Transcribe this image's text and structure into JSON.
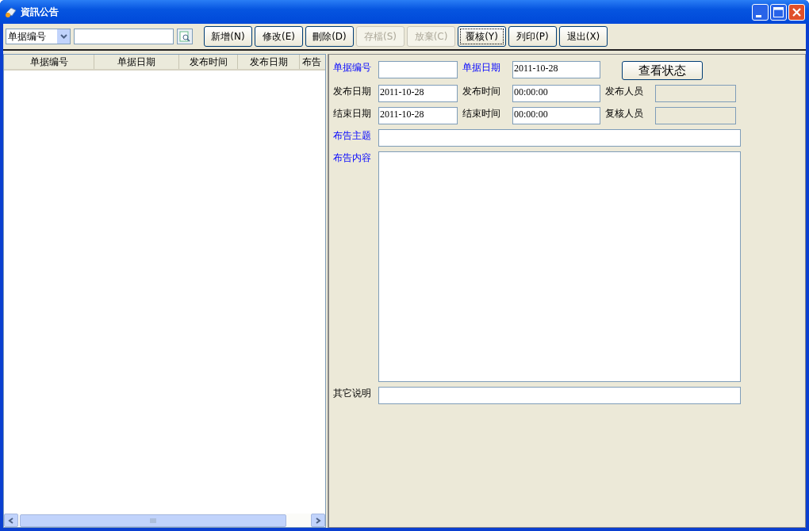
{
  "window": {
    "title": "資訊公告"
  },
  "toolbar": {
    "filter_field": {
      "value": "单据编号"
    },
    "buttons": [
      {
        "label": "新增(N)",
        "disabled": false,
        "focused": false
      },
      {
        "label": "修改(E)",
        "disabled": false,
        "focused": false
      },
      {
        "label": "刪除(D)",
        "disabled": false,
        "focused": false
      },
      {
        "label": "存檔(S)",
        "disabled": true,
        "focused": false
      },
      {
        "label": "放棄(C)",
        "disabled": true,
        "focused": false
      },
      {
        "label": "覆核(Y)",
        "disabled": false,
        "focused": true
      },
      {
        "label": "列印(P)",
        "disabled": false,
        "focused": false
      },
      {
        "label": "退出(X)",
        "disabled": false,
        "focused": false
      }
    ]
  },
  "list": {
    "columns": [
      "单据编号",
      "单据日期",
      "发布时间",
      "发布日期",
      "布告"
    ]
  },
  "form": {
    "fields": [
      {
        "kind": "short",
        "label": "单据编号",
        "required": true,
        "disabled": false
      },
      {
        "kind": "short",
        "label": "单据日期",
        "required": true,
        "disabled": false,
        "value": "2011-10-28"
      },
      {
        "kind": "button",
        "label": "查看状态"
      },
      {
        "kind": "short",
        "label": "发布日期",
        "required": false,
        "disabled": false,
        "value": "2011-10-28"
      },
      {
        "kind": "short",
        "label": "发布时间",
        "required": false,
        "disabled": false,
        "value": "00:00:00"
      },
      {
        "kind": "short",
        "label": "发布人员",
        "required": false,
        "disabled": true
      },
      {
        "kind": "short",
        "label": "结束日期",
        "required": false,
        "disabled": false,
        "value": "2011-10-28"
      },
      {
        "kind": "short",
        "label": "结束时间",
        "required": false,
        "disabled": false,
        "value": "00:00:00"
      },
      {
        "kind": "short",
        "label": "复核人员",
        "required": false,
        "disabled": true
      },
      {
        "kind": "wide",
        "label": "布告主题",
        "required": true,
        "disabled": false
      },
      {
        "kind": "area",
        "label": "布告内容",
        "required": true,
        "disabled": false
      },
      {
        "kind": "wide",
        "label": "其它说明",
        "required": false,
        "disabled": false
      }
    ]
  }
}
